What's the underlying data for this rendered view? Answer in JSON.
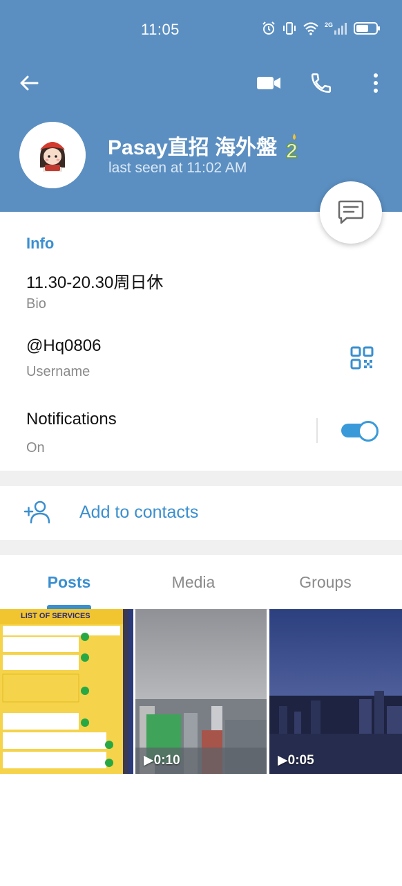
{
  "status_bar": {
    "time": "11:05"
  },
  "header": {
    "icons": [
      "back-arrow-icon",
      "video-call-icon",
      "phone-icon",
      "more-vert-icon"
    ]
  },
  "profile": {
    "name": "Pasay直招 海外盤",
    "status": "last seen at 11:02 AM"
  },
  "info": {
    "title": "Info",
    "bio_value": "11.30-20.30周日休",
    "bio_label": "Bio",
    "username_value": "@Hq0806",
    "username_label": "Username",
    "notifications_value": "Notifications",
    "notifications_label": "On",
    "notifications_enabled": true
  },
  "actions": {
    "add_contacts": "Add to contacts"
  },
  "tabs": [
    {
      "label": "Posts",
      "active": true
    },
    {
      "label": "Media",
      "active": false
    },
    {
      "label": "Groups",
      "active": false
    }
  ],
  "media": [
    {
      "kind": "image",
      "caption": "LIST OF SERVICES"
    },
    {
      "kind": "video",
      "duration": "0:10"
    },
    {
      "kind": "video",
      "duration": "0:05"
    }
  ],
  "colors": {
    "header": "#5b8fc2",
    "accent": "#3a8fcf"
  }
}
